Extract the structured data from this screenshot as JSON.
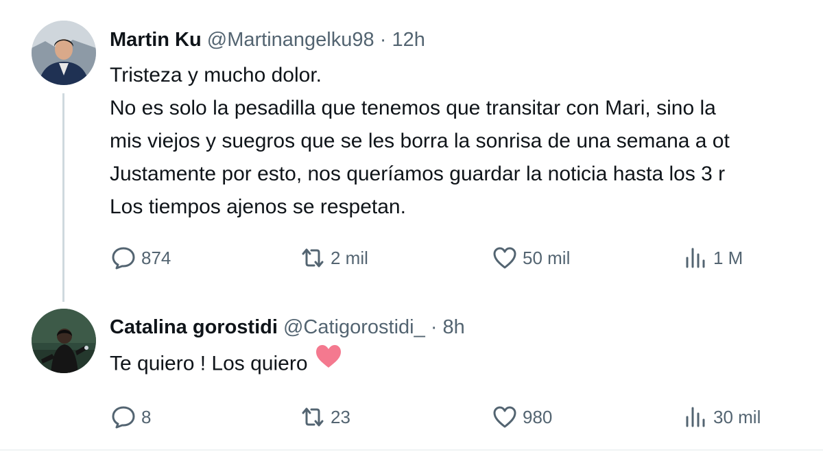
{
  "tweets": [
    {
      "author": "Martin Ku",
      "handle": "@Martinangelku98",
      "separator": "·",
      "time": "12h",
      "lines": [
        "Tristeza y mucho dolor.",
        "No es solo la pesadilla que tenemos que transitar con Mari, sino la",
        "mis viejos y suegros que se les borra la sonrisa de una semana a ot",
        "Justamente por esto, nos queríamos guardar la noticia hasta los 3 r",
        "Los tiempos ajenos se respetan."
      ],
      "stats": {
        "replies": "874",
        "retweets": "2 mil",
        "likes": "50 mil",
        "views": "1 M"
      }
    },
    {
      "author": "Catalina gorostidi",
      "handle": "@Catigorostidi_",
      "separator": "·",
      "time": "8h",
      "lines": [
        "Te quiero ! Los quiero"
      ],
      "emoji": "pink-heart",
      "stats": {
        "replies": "8",
        "retweets": "23",
        "likes": "980",
        "views": "30 mil"
      }
    }
  ],
  "icons": [
    "reply-icon",
    "retweet-icon",
    "like-icon",
    "views-icon"
  ],
  "colors": {
    "text": "#0f1419",
    "muted": "#536471",
    "thread_line": "#cfd9de",
    "heart_emoji": "#f4798f"
  }
}
